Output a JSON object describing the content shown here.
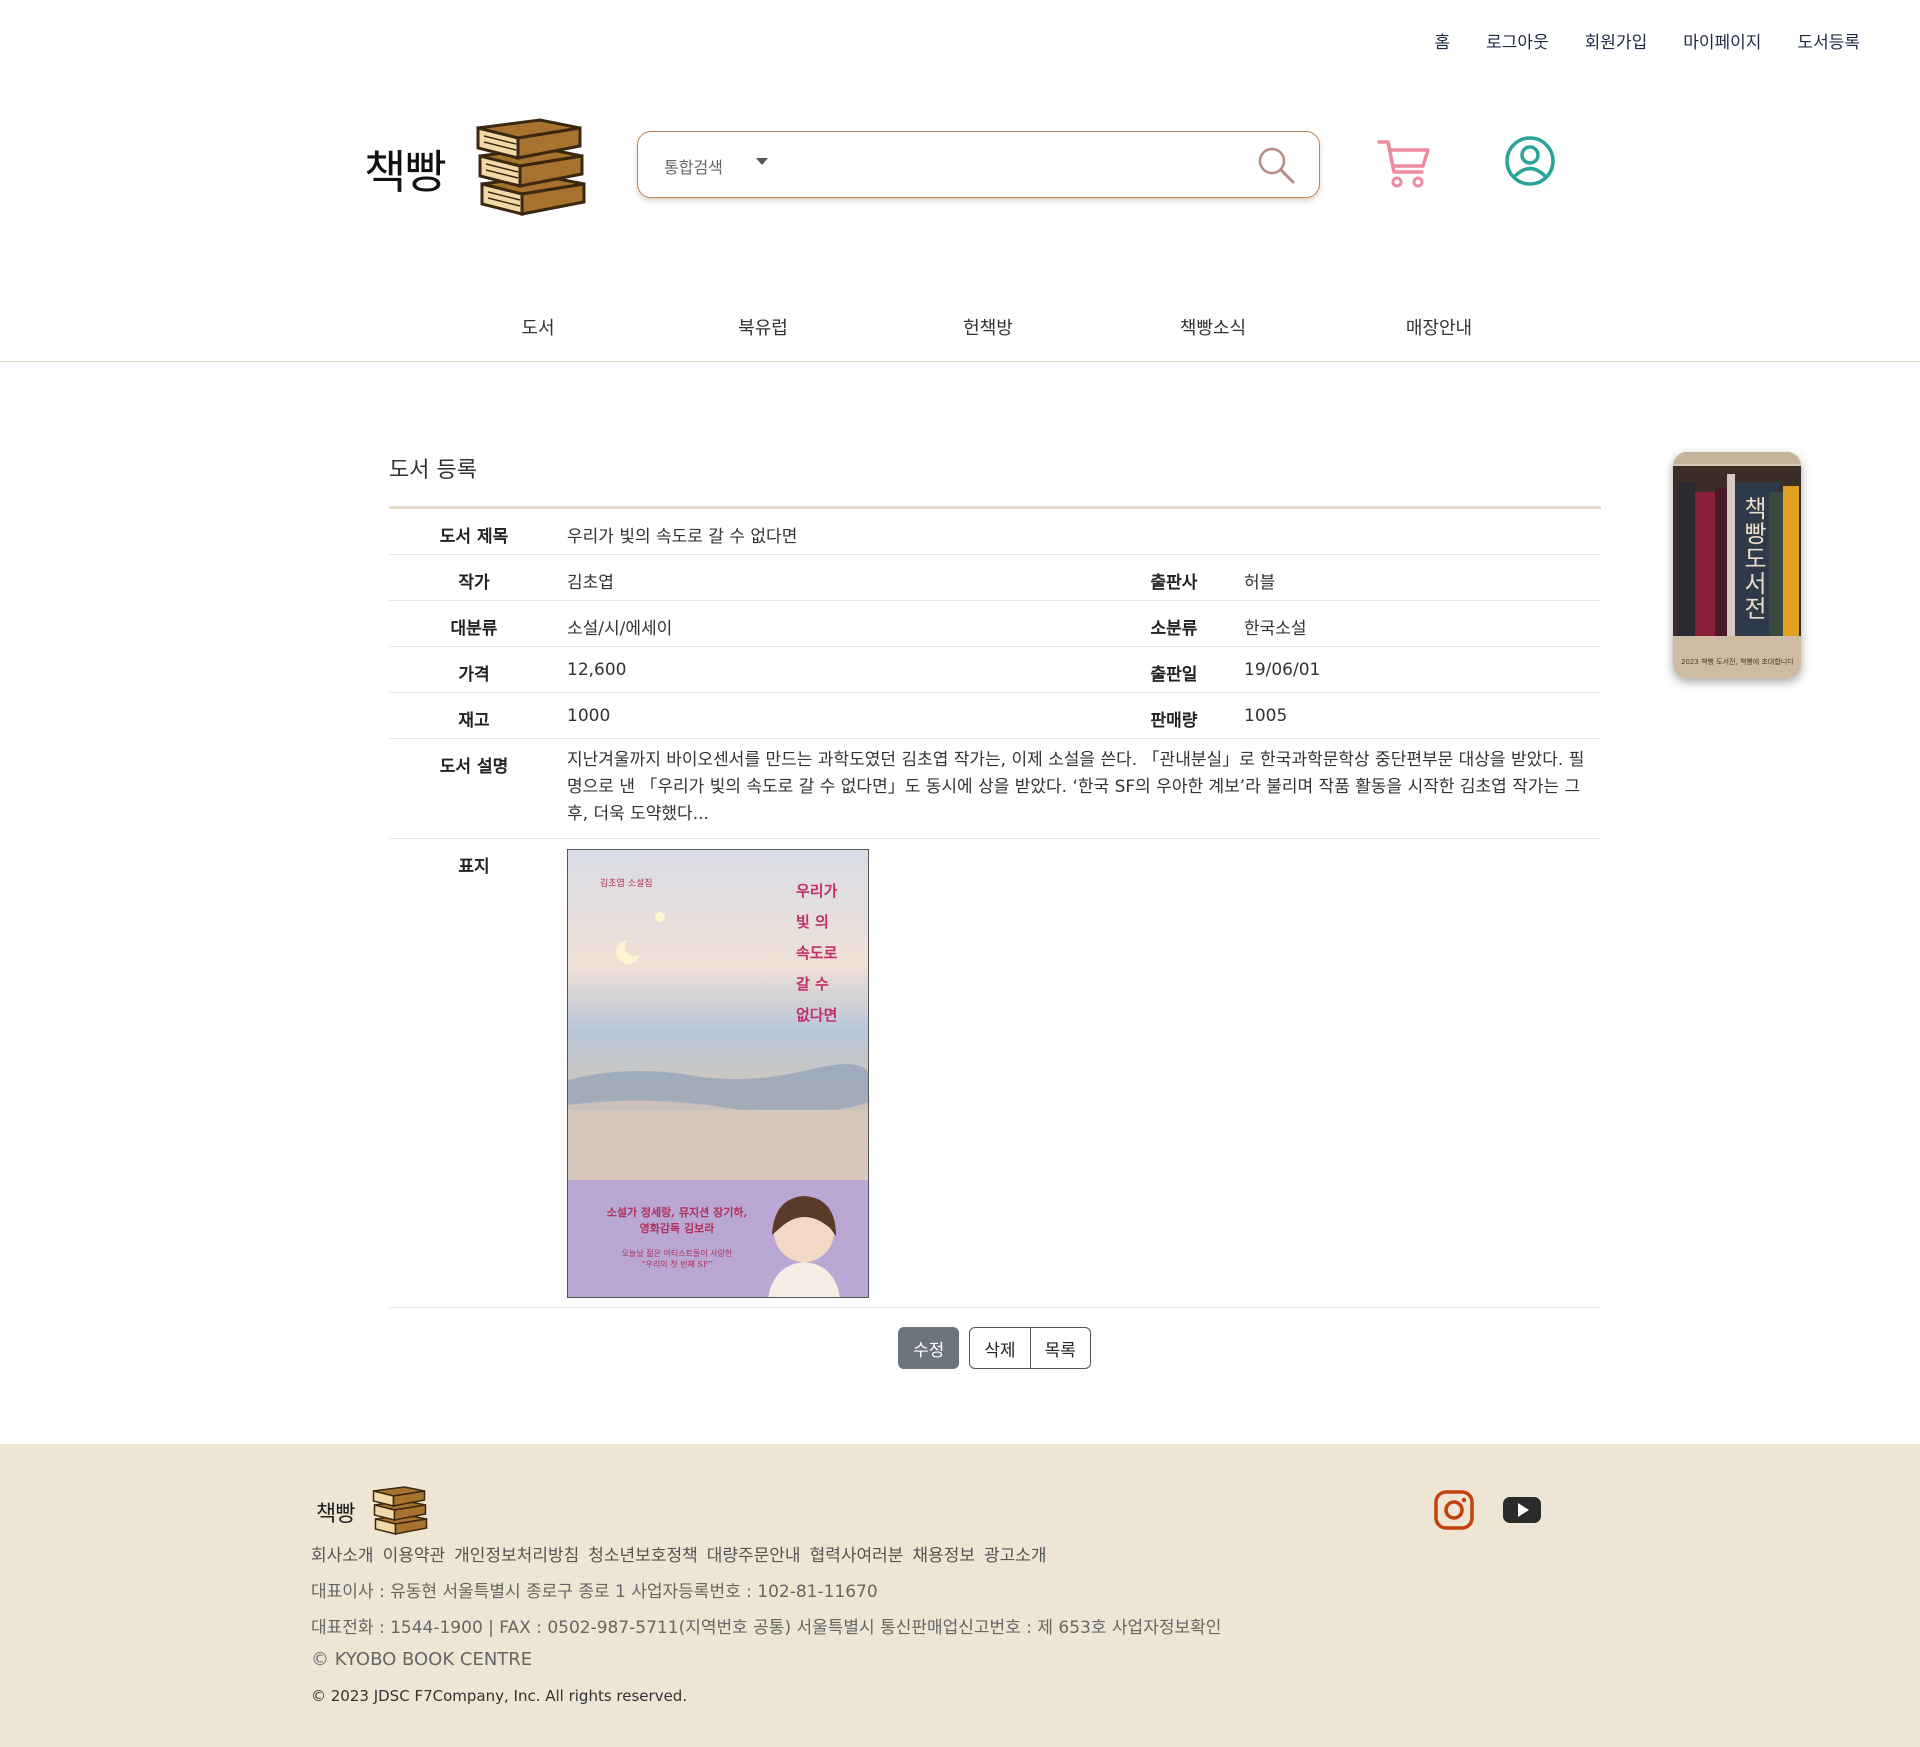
{
  "top_nav": [
    "홈",
    "로그아웃",
    "회원가입",
    "마이페이지",
    "도서등록"
  ],
  "logo_text": "책빵",
  "search": {
    "category": "통합검색",
    "placeholder": ""
  },
  "main_menu": [
    "도서",
    "북유럽",
    "헌책방",
    "책빵소식",
    "매장안내"
  ],
  "page_title": "도서 등록",
  "book": {
    "title_label": "도서 제목",
    "title": "우리가 빛의 속도로 갈 수 없다면",
    "author_label": "작가",
    "author": "김초엽",
    "publisher_label": "출판사",
    "publisher": "허블",
    "major_label": "대분류",
    "major": "소설/시/에세이",
    "minor_label": "소분류",
    "minor": "한국소설",
    "price_label": "가격",
    "price": "12,600",
    "date_label": "출판일",
    "date": "19/06/01",
    "stock_label": "재고",
    "stock": "1000",
    "sales_label": "판매량",
    "sales": "1005",
    "desc_label": "도서 설명",
    "desc": "지난겨울까지 바이오센서를 만드는 과학도였던 김초엽 작가는, 이제 소설을 쓴다. 「관내분실」로 한국과학문학상 중단편부문 대상을 받았다. 필명으로 낸 「우리가 빛의 속도로 갈 수 없다면」도 동시에 상을 받았다. ‘한국 SF의 우아한 계보’라 불리며 작품 활동을 시작한 김초엽 작가는 그 후, 더욱 도약했다...",
    "cover_label": "표지"
  },
  "cover": {
    "series": "김초엽 소설집",
    "title_lines": [
      "우리가",
      "빛  의",
      "속도로",
      "갈  수",
      "없다면"
    ],
    "blurb1": "소설가 정세랑, 뮤지션 장기하,",
    "blurb2": "영화감독 김보라",
    "blurb3": "오늘날 젊은 아티스트들이 사랑한",
    "blurb4": "“우리의 첫 번째 SF”"
  },
  "buttons": {
    "edit": "수정",
    "delete": "삭제",
    "list": "목록"
  },
  "side_banner": {
    "title": "책빵도서전",
    "caption": "2023 책빵 도서전, 책빵에 초대합니다"
  },
  "footer": {
    "links": [
      "회사소개",
      "이용약관",
      "개인정보처리방침",
      "청소년보호정책",
      "대량주문안내",
      "협력사여러분",
      "채용정보",
      "광고소개"
    ],
    "line1": "대표이사 : 유동현 서울특별시 종로구 종로 1 사업자등록번호 : 102-81-11670",
    "line2": "대표전화 : 1544-1900 | FAX : 0502-987-5711(지역번호 공통) 서울특별시 통신판매업신고번호 : 제 653호 사업자정보확인",
    "line3": "© KYOBO BOOK CENTRE",
    "line4": "© 2023 JDSC F7Company, Inc. All rights reserved."
  },
  "colors": {
    "accent": "#b8875a",
    "footer_bg": "#efe5d4",
    "cart": "#ee8aa0",
    "user": "#2aa39a",
    "btn_primary": "#6c757d"
  }
}
